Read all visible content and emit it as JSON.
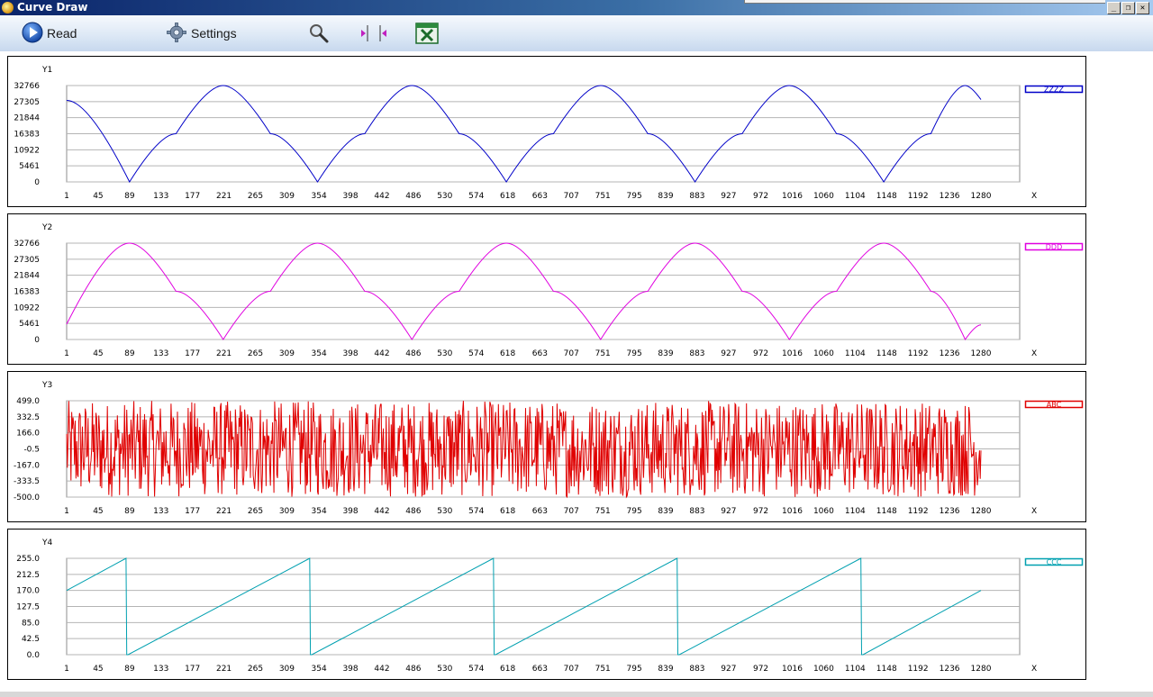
{
  "window": {
    "title": "Curve Draw",
    "controls": [
      "_",
      "❐",
      "✕"
    ]
  },
  "toolbar": {
    "read_label": "Read",
    "settings_label": "Settings",
    "icons": [
      "play-icon",
      "gear-icon",
      "magnifier-icon",
      "cursor-left-icon",
      "cursor-right-icon",
      "excel-icon"
    ]
  },
  "x_axis": {
    "label": "X",
    "ticks": [
      "1",
      "45",
      "89",
      "133",
      "177",
      "221",
      "265",
      "309",
      "354",
      "398",
      "442",
      "486",
      "530",
      "574",
      "618",
      "663",
      "707",
      "751",
      "795",
      "839",
      "883",
      "927",
      "972",
      "1016",
      "1060",
      "1104",
      "1148",
      "1192",
      "1236",
      "1280"
    ]
  },
  "chart_data": [
    {
      "type": "line",
      "ylabel": "Y1",
      "legend": "ZZZZ",
      "color": "#0000c8",
      "yticks": [
        "32766",
        "27305",
        "21844",
        "16383",
        "10922",
        "5461",
        "0"
      ],
      "ylim": [
        0,
        32766
      ],
      "xlim": [
        1,
        1280
      ],
      "grid": true,
      "series": [
        {
          "name": "ZZZZ",
          "x": [
            1,
            89,
            154,
            220,
            286,
            352,
            418,
            484,
            550,
            616,
            682,
            748,
            814,
            880,
            946,
            1012,
            1078,
            1144,
            1210,
            1258,
            1280
          ],
          "y": [
            27700,
            0,
            16383,
            32766,
            16383,
            0,
            16383,
            32766,
            16383,
            0,
            16383,
            32766,
            16383,
            0,
            16383,
            32766,
            16383,
            0,
            16383,
            32766,
            28000
          ]
        }
      ]
    },
    {
      "type": "line",
      "ylabel": "Y2",
      "legend": "DDD",
      "color": "#e000e0",
      "yticks": [
        "32766",
        "27305",
        "21844",
        "16383",
        "10922",
        "5461",
        "0"
      ],
      "ylim": [
        0,
        32766
      ],
      "xlim": [
        1,
        1280
      ],
      "grid": true,
      "series": [
        {
          "name": "DDD",
          "x": [
            1,
            89,
            154,
            220,
            286,
            352,
            418,
            484,
            550,
            616,
            682,
            748,
            814,
            880,
            946,
            1012,
            1078,
            1144,
            1210,
            1258,
            1280
          ],
          "y": [
            5200,
            32766,
            16383,
            0,
            16383,
            32766,
            16383,
            0,
            16383,
            32766,
            16383,
            0,
            16383,
            32766,
            16383,
            0,
            16383,
            32766,
            16383,
            0,
            5000
          ]
        }
      ]
    },
    {
      "type": "line",
      "ylabel": "Y3",
      "legend": "ABC",
      "color": "#e00000",
      "yticks": [
        "499.0",
        "332.5",
        "166.0",
        "-0.5",
        "-167.0",
        "-333.5",
        "-500.0"
      ],
      "ylim": [
        -500,
        499
      ],
      "xlim": [
        1,
        1280
      ],
      "grid": true,
      "series": [
        {
          "name": "ABC",
          "x": [
            1,
            1280
          ],
          "y_range": [
            -500,
            499
          ],
          "samples": 1280
        }
      ]
    },
    {
      "type": "line",
      "ylabel": "Y4",
      "legend": "CCC",
      "color": "#00a0b0",
      "yticks": [
        "255.0",
        "212.5",
        "170.0",
        "127.5",
        "85.0",
        "42.5",
        "0.0"
      ],
      "ylim": [
        0,
        255
      ],
      "xlim": [
        1,
        1280
      ],
      "grid": true,
      "series": [
        {
          "name": "CCC",
          "x": [
            1,
            84,
            85,
            87,
            341,
            342,
            344,
            598,
            599,
            601,
            855,
            856,
            858,
            1112,
            1113,
            1115,
            1280
          ],
          "y": [
            170,
            255,
            0,
            0,
            255,
            0,
            0,
            255,
            0,
            0,
            255,
            0,
            0,
            255,
            0,
            0,
            170
          ]
        }
      ]
    }
  ]
}
